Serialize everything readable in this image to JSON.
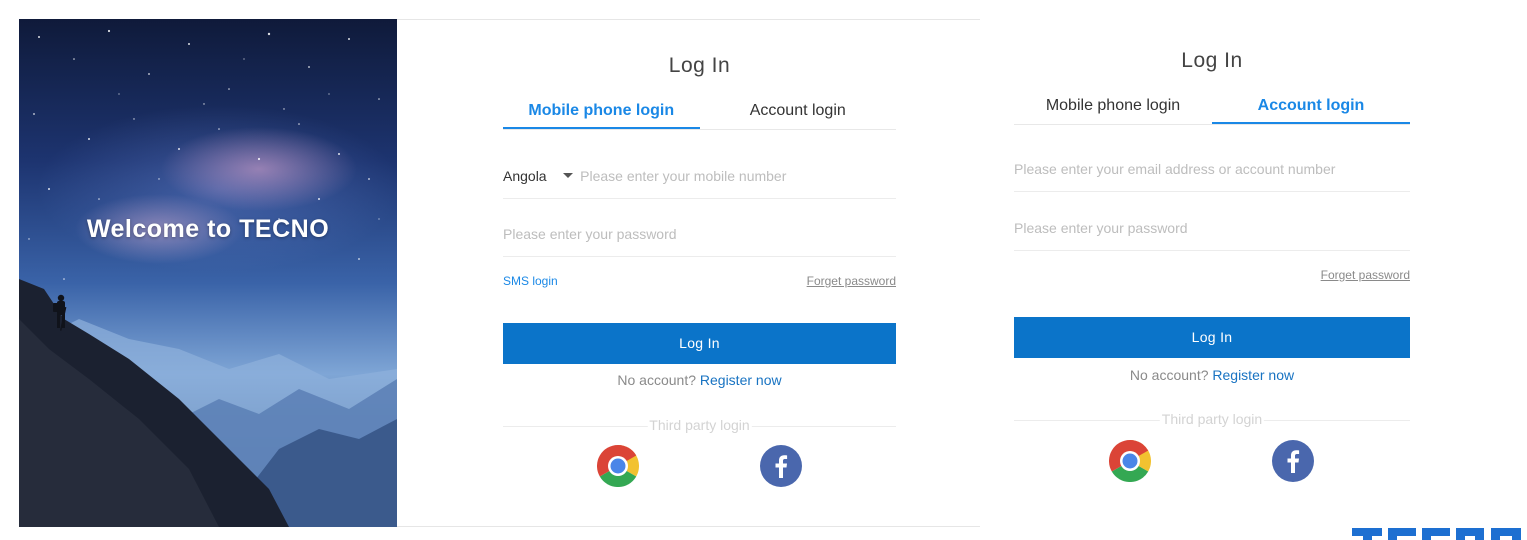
{
  "hero": {
    "welcome_text": "Welcome to TECNO"
  },
  "card1": {
    "title": "Log In",
    "tabs": [
      {
        "label": "Mobile phone login",
        "active": true
      },
      {
        "label": "Account login",
        "active": false
      }
    ],
    "country": "Angola",
    "mobile_placeholder": "Please enter your mobile number",
    "password_placeholder": "Please enter your password",
    "sms_login": "SMS login",
    "forget_password": "Forget password",
    "login_button": "Log In",
    "no_account": "No account?",
    "register_now": "Register now",
    "third_party": "Third party login"
  },
  "card2": {
    "title": "Log In",
    "tabs": [
      {
        "label": "Mobile phone login",
        "active": false
      },
      {
        "label": "Account login",
        "active": true
      }
    ],
    "email_placeholder": "Please enter your email address or account number",
    "password_placeholder": "Please enter your password",
    "forget_password": "Forget password",
    "login_button": "Log In",
    "no_account": "No account?",
    "register_now": "Register now",
    "third_party": "Third party login"
  },
  "brand": {
    "logo_text": "TECNO"
  },
  "colors": {
    "accent": "#1a88e6",
    "button": "#0b74c9",
    "facebook": "#4a67ad",
    "brand": "#1d6fd1"
  },
  "icons": {
    "chrome": "chrome-icon",
    "facebook": "facebook-icon",
    "dropdown": "caret-down-icon"
  }
}
